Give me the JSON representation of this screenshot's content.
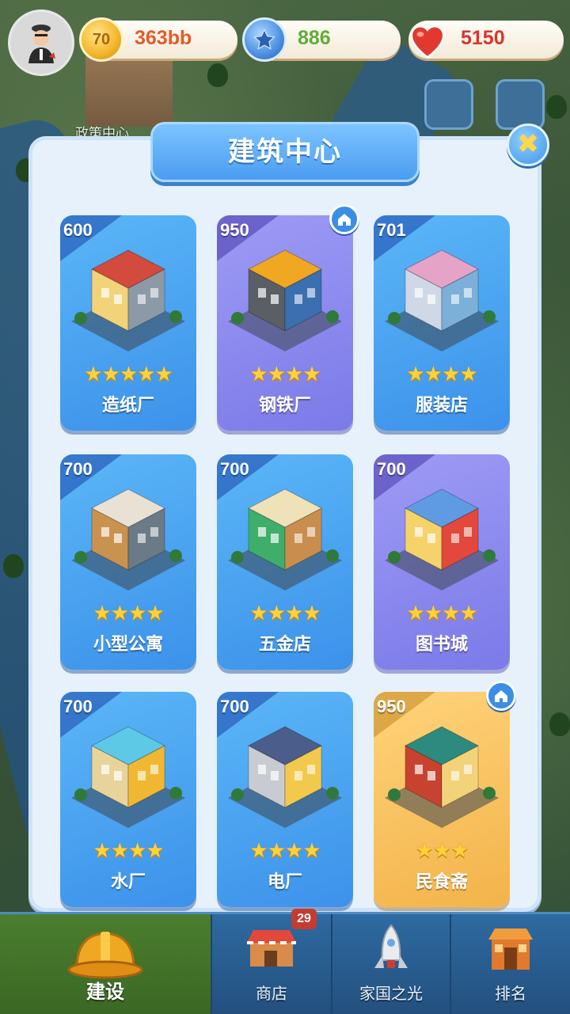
{
  "background": {
    "map_label": "政策中心"
  },
  "resources": {
    "coin": {
      "icon": "coin-icon",
      "coin_face": "70",
      "value": "363bb"
    },
    "star": {
      "icon": "star-coin-icon",
      "value": "886"
    },
    "heart": {
      "icon": "heart-icon",
      "value": "5150"
    }
  },
  "panel": {
    "title": "建筑中心",
    "close_label": "✖"
  },
  "buildings": [
    {
      "name": "造纸厂",
      "cost": "600",
      "stars": 5,
      "style": "blue",
      "home": false
    },
    {
      "name": "钢铁厂",
      "cost": "950",
      "stars": 4,
      "style": "purple",
      "home": true
    },
    {
      "name": "服装店",
      "cost": "701",
      "stars": 4,
      "style": "blue",
      "home": false
    },
    {
      "name": "小型公寓",
      "cost": "700",
      "stars": 4,
      "style": "blue",
      "home": false
    },
    {
      "name": "五金店",
      "cost": "700",
      "stars": 4,
      "style": "blue",
      "home": false
    },
    {
      "name": "图书城",
      "cost": "700",
      "stars": 4,
      "style": "purple",
      "home": false
    },
    {
      "name": "水厂",
      "cost": "700",
      "stars": 4,
      "style": "blue",
      "home": false
    },
    {
      "name": "电厂",
      "cost": "700",
      "stars": 4,
      "style": "blue",
      "home": false
    },
    {
      "name": "民食斋",
      "cost": "950",
      "stars": 3,
      "style": "gold",
      "home": true
    }
  ],
  "nav": {
    "items": [
      {
        "label": "建设",
        "icon": "hard-hat-icon",
        "active": true
      },
      {
        "label": "商店",
        "icon": "shop-icon",
        "active": false
      },
      {
        "label": "家国之光",
        "icon": "rocket-icon",
        "active": false
      },
      {
        "label": "排名",
        "icon": "ranking-icon",
        "active": false
      }
    ],
    "shop_badge": "29"
  },
  "colors": {
    "card_blue": "#3c92ea",
    "card_purple": "#7b7ae8",
    "card_gold": "#f3b34a",
    "star": "#ffd23c",
    "panel_bg": "#e7f1fb"
  }
}
